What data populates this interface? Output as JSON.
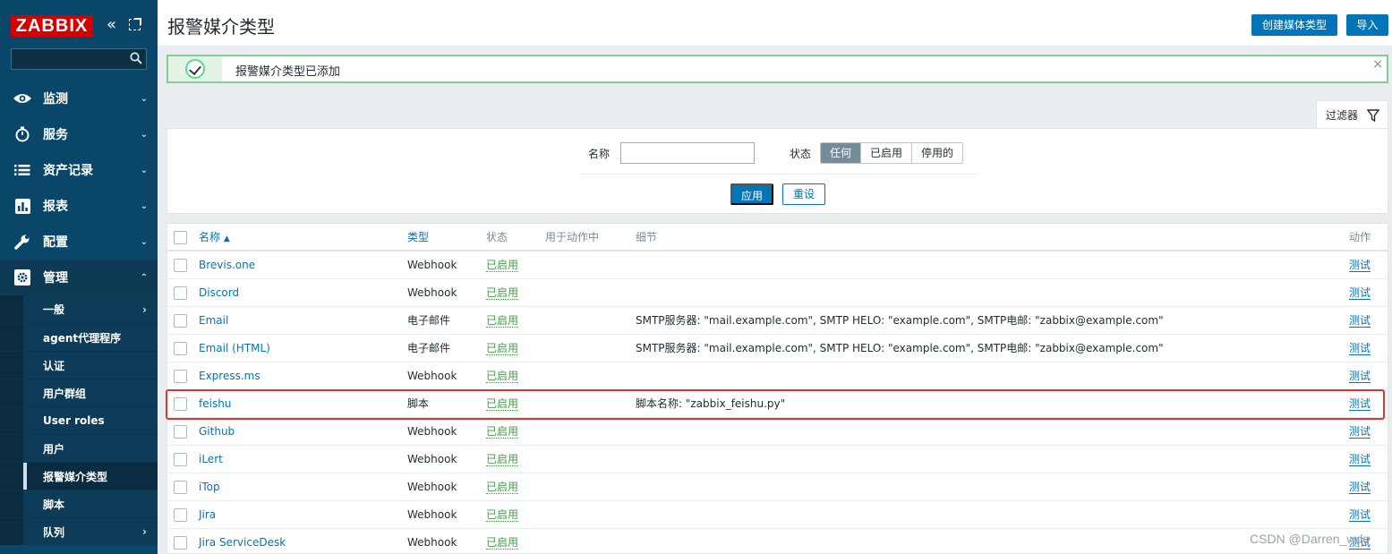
{
  "app": {
    "logo": "ZABBIX"
  },
  "sidebar": {
    "menu": [
      {
        "label": "监测",
        "icon": "eye-icon"
      },
      {
        "label": "服务",
        "icon": "timer-icon"
      },
      {
        "label": "资产记录",
        "icon": "list-icon"
      },
      {
        "label": "报表",
        "icon": "bar-chart-icon"
      },
      {
        "label": "配置",
        "icon": "wrench-icon"
      },
      {
        "label": "管理",
        "icon": "gear-icon"
      }
    ],
    "submenu": [
      {
        "label": "一般"
      },
      {
        "label": "agent代理程序"
      },
      {
        "label": "认证"
      },
      {
        "label": "用户群组"
      },
      {
        "label": "User roles"
      },
      {
        "label": "用户"
      },
      {
        "label": "报警媒介类型"
      },
      {
        "label": "脚本"
      },
      {
        "label": "队列"
      }
    ]
  },
  "header": {
    "title": "报警媒介类型",
    "create_label": "创建媒体类型",
    "import_label": "导入"
  },
  "message": {
    "text": "报警媒介类型已添加",
    "close": "×"
  },
  "filter": {
    "tab_label": "过滤器",
    "name_label": "名称",
    "name_value": "",
    "status_label": "状态",
    "status_options": [
      "任何",
      "已启用",
      "停用的"
    ],
    "status_selected": "任何",
    "apply_label": "应用",
    "reset_label": "重设"
  },
  "table": {
    "columns": {
      "name": "名称",
      "sort_arrow": "▲",
      "type": "类型",
      "status": "状态",
      "used_in_actions": "用于动作中",
      "details": "细节",
      "action": "动作"
    },
    "rows": [
      {
        "name": "Brevis.one",
        "type": "Webhook",
        "status": "已启用",
        "details": "",
        "action": "测试"
      },
      {
        "name": "Discord",
        "type": "Webhook",
        "status": "已启用",
        "details": "",
        "action": "测试"
      },
      {
        "name": "Email",
        "type": "电子邮件",
        "status": "已启用",
        "details": "SMTP服务器: \"mail.example.com\", SMTP HELO: \"example.com\", SMTP电邮: \"zabbix@example.com\"",
        "action": "测试"
      },
      {
        "name": "Email (HTML)",
        "type": "电子邮件",
        "status": "已启用",
        "details": "SMTP服务器: \"mail.example.com\", SMTP HELO: \"example.com\", SMTP电邮: \"zabbix@example.com\"",
        "action": "测试"
      },
      {
        "name": "Express.ms",
        "type": "Webhook",
        "status": "已启用",
        "details": "",
        "action": "测试"
      },
      {
        "name": "feishu",
        "type": "脚本",
        "status": "已启用",
        "details": "脚本名称: \"zabbix_feishu.py\"",
        "action": "测试"
      },
      {
        "name": "Github",
        "type": "Webhook",
        "status": "已启用",
        "details": "",
        "action": "测试"
      },
      {
        "name": "iLert",
        "type": "Webhook",
        "status": "已启用",
        "details": "",
        "action": "测试"
      },
      {
        "name": "iTop",
        "type": "Webhook",
        "status": "已启用",
        "details": "",
        "action": "测试"
      },
      {
        "name": "Jira",
        "type": "Webhook",
        "status": "已启用",
        "details": "",
        "action": "测试"
      },
      {
        "name": "Jira ServiceDesk",
        "type": "Webhook",
        "status": "已启用",
        "details": "",
        "action": "测试"
      }
    ]
  },
  "watermark": "CSDN @Darren_wdq",
  "colors": {
    "sidebar": "#0a466a",
    "accent": "#0275b8",
    "enabled": "#429e47",
    "highlight": "#e5322b"
  }
}
